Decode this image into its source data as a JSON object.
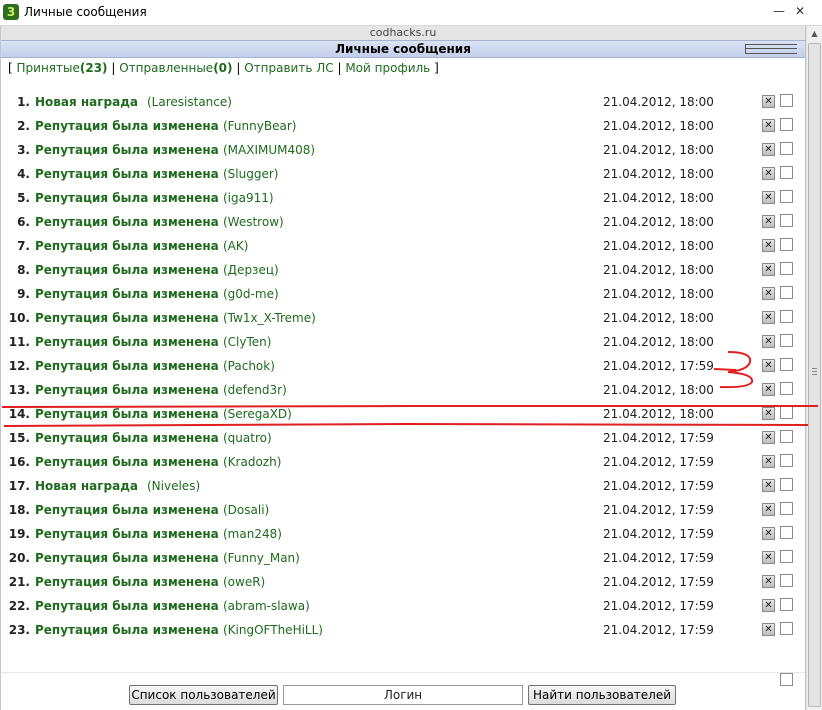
{
  "window": {
    "title": "Личные сообщения",
    "app_icon_glyph": "3",
    "minimize_glyph": "—",
    "close_glyph": "✕"
  },
  "site": {
    "domain": "codhacks.ru"
  },
  "header": {
    "title": "Личные сообщения"
  },
  "nav": {
    "open_bracket": "[",
    "close_bracket": "]",
    "separator": "|",
    "received_label": "Принятые",
    "received_count": "(23)",
    "sent_label": "Отправленные",
    "sent_count": "(0)",
    "send_pm": "Отправить ЛС",
    "my_profile": "Мой профиль"
  },
  "messages": [
    {
      "num": "1.",
      "subject": "Новая награда",
      "sender": "(Laresistance)",
      "date": "21.04.2012, 18:00"
    },
    {
      "num": "2.",
      "subject": "Репутация была изменена",
      "sender": "(FunnyBear)",
      "date": "21.04.2012, 18:00"
    },
    {
      "num": "3.",
      "subject": "Репутация была изменена",
      "sender": "(MAXIMUM408)",
      "date": "21.04.2012, 18:00"
    },
    {
      "num": "4.",
      "subject": "Репутация была изменена",
      "sender": "(Slugger)",
      "date": "21.04.2012, 18:00"
    },
    {
      "num": "5.",
      "subject": "Репутация была изменена",
      "sender": "(iga911)",
      "date": "21.04.2012, 18:00"
    },
    {
      "num": "6.",
      "subject": "Репутация была изменена",
      "sender": "(Westrow)",
      "date": "21.04.2012, 18:00"
    },
    {
      "num": "7.",
      "subject": "Репутация была изменена",
      "sender": "(AK)",
      "date": "21.04.2012, 18:00"
    },
    {
      "num": "8.",
      "subject": "Репутация была изменена",
      "sender": "(Дерзец)",
      "date": "21.04.2012, 18:00"
    },
    {
      "num": "9.",
      "subject": "Репутация была изменена",
      "sender": "(g0d-me)",
      "date": "21.04.2012, 18:00"
    },
    {
      "num": "10.",
      "subject": "Репутация была изменена",
      "sender": "(Tw1x_X-Treme)",
      "date": "21.04.2012, 18:00"
    },
    {
      "num": "11.",
      "subject": "Репутация была изменена",
      "sender": "(ClyTen)",
      "date": "21.04.2012, 18:00"
    },
    {
      "num": "12.",
      "subject": "Репутация была изменена",
      "sender": "(Pachok)",
      "date": "21.04.2012, 17:59"
    },
    {
      "num": "13.",
      "subject": "Репутация была изменена",
      "sender": "(defend3r)",
      "date": "21.04.2012, 18:00"
    },
    {
      "num": "14.",
      "subject": "Репутация была изменена",
      "sender": "(SeregaXD)",
      "date": "21.04.2012, 18:00"
    },
    {
      "num": "15.",
      "subject": "Репутация была изменена",
      "sender": "(quatro)",
      "date": "21.04.2012, 17:59"
    },
    {
      "num": "16.",
      "subject": "Репутация была изменена",
      "sender": "(Kradozh)",
      "date": "21.04.2012, 17:59"
    },
    {
      "num": "17.",
      "subject": "Новая награда",
      "sender": "(Niveles)",
      "date": "21.04.2012, 17:59"
    },
    {
      "num": "18.",
      "subject": "Репутация была изменена",
      "sender": "(Dosali)",
      "date": "21.04.2012, 17:59"
    },
    {
      "num": "19.",
      "subject": "Репутация была изменена",
      "sender": "(man248)",
      "date": "21.04.2012, 17:59"
    },
    {
      "num": "20.",
      "subject": "Репутация была изменена",
      "sender": "(Funny_Man)",
      "date": "21.04.2012, 17:59"
    },
    {
      "num": "21.",
      "subject": "Репутация была изменена",
      "sender": "(oweR)",
      "date": "21.04.2012, 17:59"
    },
    {
      "num": "22.",
      "subject": "Репутация была изменена",
      "sender": "(abram-slawa)",
      "date": "21.04.2012, 17:59"
    },
    {
      "num": "23.",
      "subject": "Репутация была изменена",
      "sender": "(KingOFTheHiLL)",
      "date": "21.04.2012, 17:59"
    }
  ],
  "delete_glyph": "✕",
  "footer": {
    "user_list_button": "Список пользователей",
    "login_value": "Логин",
    "find_user_button": "Найти пользователей"
  },
  "colors": {
    "link_green": "#1e6b1e",
    "header_blue": "#c3cfea",
    "annotation_red": "#e02020"
  }
}
